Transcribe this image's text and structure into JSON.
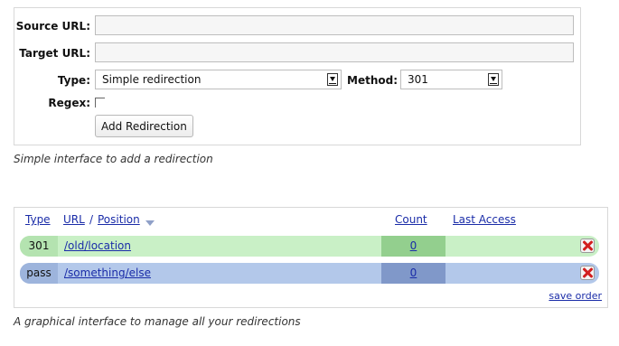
{
  "form": {
    "source_label": "Source URL:",
    "source_value": "",
    "target_label": "Target URL:",
    "target_value": "",
    "type_label": "Type:",
    "type_selected": "Simple redirection",
    "method_label": "Method:",
    "method_selected": "301",
    "regex_label": "Regex:",
    "regex_checked": false,
    "add_button": "Add Redirection",
    "caption": "Simple interface to add a redirection"
  },
  "list": {
    "headers": {
      "type": "Type",
      "url": "URL",
      "separator": "/",
      "position": "Position",
      "count": "Count",
      "last_access": "Last Access"
    },
    "rows": [
      {
        "type": "301",
        "url": "/old/location",
        "count": "0",
        "last_access": ""
      },
      {
        "type": "pass",
        "url": "/something/else",
        "count": "0",
        "last_access": ""
      }
    ],
    "save_order": "save order",
    "caption": "A graphical interface to manage all your redirections"
  },
  "colors": {
    "row1_bg": "#c9f0c6",
    "row1_type_bg": "#b4e3b0",
    "row1_count_bg": "#93cf8e",
    "row2_bg": "#b3c8ea",
    "row2_type_bg": "#9db4dc",
    "row2_count_bg": "#8098c9",
    "link": "#1a2ca8"
  },
  "icons": {
    "delete": "delete-x-icon",
    "sort": "sort-down-icon",
    "select_arrow": "dropdown-arrow-icon"
  }
}
